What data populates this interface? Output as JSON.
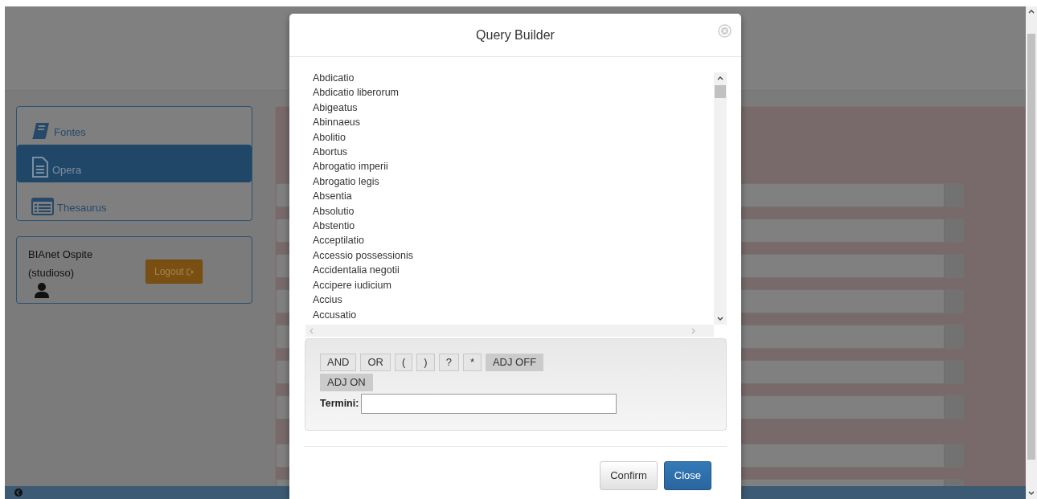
{
  "sidebar": {
    "items": [
      {
        "label": "Fontes",
        "selected": false
      },
      {
        "label": "Opera",
        "selected": true
      },
      {
        "label": "Thesaurus",
        "selected": false
      }
    ]
  },
  "user": {
    "name": "BIAnet Ospite",
    "role": "(studioso)",
    "logout": "Logout"
  },
  "modal": {
    "title": "Query Builder",
    "terms": [
      "Abdicatio",
      "Abdicatio liberorum",
      "Abigeatus",
      "Abinnaeus",
      "Abolitio",
      "Abortus",
      "Abrogatio imperii",
      "Abrogatio legis",
      "Absentia",
      "Absolutio",
      "Abstentio",
      "Acceptilatio",
      "Accessio possessionis",
      "Accidentalia negotii",
      "Accipere iudicium",
      "Accius",
      "Accusatio"
    ],
    "operators": [
      {
        "label": "AND",
        "kind": "operator"
      },
      {
        "label": "OR",
        "kind": "operator"
      },
      {
        "label": "(",
        "kind": "operator"
      },
      {
        "label": ")",
        "kind": "operator"
      },
      {
        "label": "?",
        "kind": "operator"
      },
      {
        "label": "*",
        "kind": "operator"
      },
      {
        "label": "ADJ OFF",
        "kind": "toggle"
      },
      {
        "label": "ADJ ON",
        "kind": "toggle"
      }
    ],
    "field_label": "Termini:",
    "buttons": [
      {
        "label": "Confirm",
        "kind": "default"
      },
      {
        "label": "Close",
        "kind": "primary"
      }
    ]
  }
}
